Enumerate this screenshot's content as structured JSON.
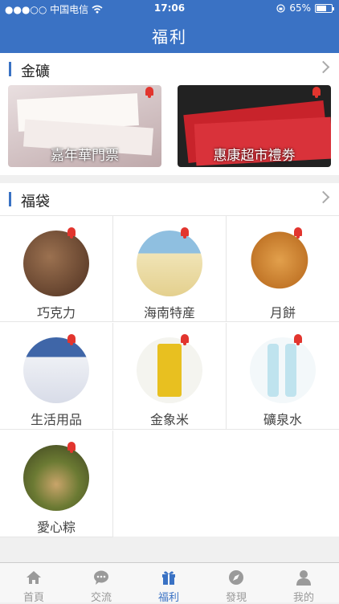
{
  "status": {
    "carrier": "●●●○○ 中国电信",
    "time": "17:06",
    "battery": "65%"
  },
  "header": {
    "title": "福利"
  },
  "section1": {
    "title": "金礦",
    "cards": [
      {
        "label": "嘉年華門票",
        "color": "#c9b3b6"
      },
      {
        "label": "惠康超市禮劵",
        "color": "#b8202a"
      }
    ]
  },
  "section2": {
    "title": "福袋",
    "items": [
      {
        "label": "巧克力",
        "color": "#6b4a33"
      },
      {
        "label": "海南特産",
        "color": "#e7d9a7"
      },
      {
        "label": "月餅",
        "color": "#d08a3a"
      },
      {
        "label": "生活用品",
        "color": "#d9dde8"
      },
      {
        "label": "金象米",
        "color": "#f2f2ec"
      },
      {
        "label": "礦泉水",
        "color": "#dfeef3"
      },
      {
        "label": "愛心粽",
        "color": "#5f6b2f"
      }
    ]
  },
  "tabbar": {
    "tabs": [
      {
        "label": "首頁",
        "icon": "home-icon"
      },
      {
        "label": "交流",
        "icon": "chat-icon"
      },
      {
        "label": "福利",
        "icon": "gift-icon"
      },
      {
        "label": "發現",
        "icon": "compass-icon"
      },
      {
        "label": "我的",
        "icon": "person-icon"
      }
    ]
  },
  "colors": {
    "brand": "#3a72c4",
    "bell": "#e2352e"
  }
}
